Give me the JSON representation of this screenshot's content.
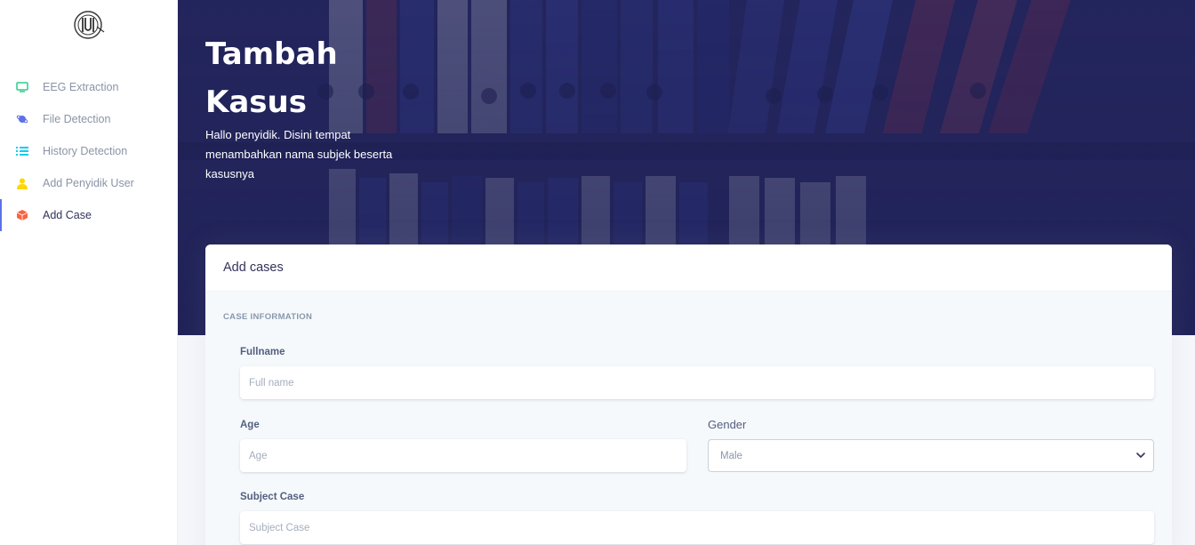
{
  "sidebar": {
    "items": [
      {
        "label": "EEG Extraction",
        "icon": "monitor-icon",
        "color": "#2dce89"
      },
      {
        "label": "File Detection",
        "icon": "planet-icon",
        "color": "#5e72e4"
      },
      {
        "label": "History Detection",
        "icon": "list-icon",
        "color": "#11cdef"
      },
      {
        "label": "Add Penyidik User",
        "icon": "user-icon",
        "color": "#ffd600"
      },
      {
        "label": "Add Case",
        "icon": "box-icon",
        "color": "#fb6340",
        "active": true
      }
    ]
  },
  "hero": {
    "title": "Tambah Kasus",
    "description": "Hallo penyidik. Disini tempat menambahkan nama subjek beserta kasusnya"
  },
  "card": {
    "title": "Add cases",
    "section": "Case Information",
    "fields": {
      "fullname": {
        "label": "Fullname",
        "placeholder": "Full name"
      },
      "age": {
        "label": "Age",
        "placeholder": "Age"
      },
      "gender": {
        "label": "Gender",
        "value": "Male"
      },
      "subject_case": {
        "label": "Subject Case",
        "placeholder": "Subject Case"
      }
    }
  },
  "colors": {
    "accent": "#5e72e4",
    "hero": "#23245a"
  }
}
